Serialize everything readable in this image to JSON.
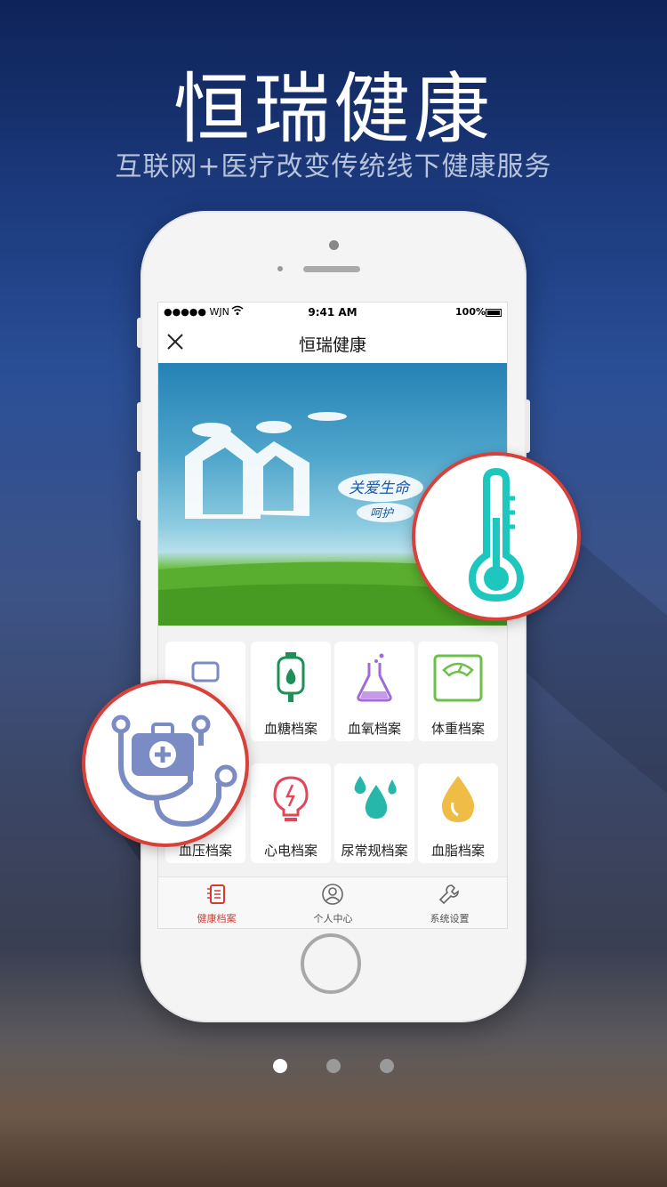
{
  "promo": {
    "title": "恒瑞健康",
    "subtitle": "互联网+医疗改变传统线下健康服务"
  },
  "status_bar": {
    "carrier": "●●●●● WJN",
    "time": "9:41 AM",
    "battery": "100%"
  },
  "nav": {
    "title": "恒瑞健康",
    "close_icon": "close-icon"
  },
  "banner": {
    "text_line1": "关爱生命",
    "text_line2": "呵护"
  },
  "tiles": [
    {
      "label": "血糖档案",
      "icon": "iv-bag-icon",
      "color": "#1f8f5a"
    },
    {
      "label": "血氧档案",
      "icon": "flask-icon",
      "color": "#a06ad8"
    },
    {
      "label": "体重档案",
      "icon": "scale-icon",
      "color": "#6cc04a"
    },
    {
      "label": "血压档案",
      "icon": "blood-pressure-icon",
      "color": "#1dc7be"
    },
    {
      "label": "心电档案",
      "icon": "bulb-icon",
      "color": "#e0485a"
    },
    {
      "label": "尿常规档案",
      "icon": "drops-icon",
      "color": "#27b6aa"
    },
    {
      "label": "血脂档案",
      "icon": "drop-icon",
      "color": "#efbc45"
    }
  ],
  "tabbar": [
    {
      "label": "健康档案",
      "icon": "records-icon",
      "active": true
    },
    {
      "label": "个人中心",
      "icon": "user-icon",
      "active": false
    },
    {
      "label": "系统设置",
      "icon": "wrench-icon",
      "active": false
    }
  ],
  "colors": {
    "accent_red": "#d8403a",
    "thermometer": "#1dc7be",
    "medkit": "#7b8bc4"
  },
  "pager": {
    "pages": 3,
    "active": 0
  }
}
